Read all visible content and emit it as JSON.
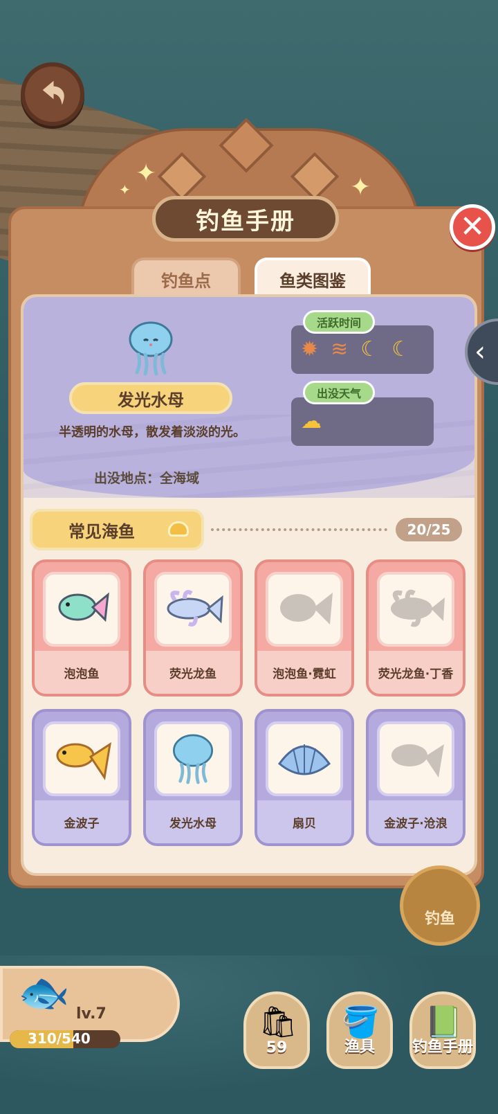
{
  "title": "钓鱼手册",
  "tabs": [
    "钓鱼点",
    "鱼类图鉴"
  ],
  "selected_fish": {
    "name": "发光水母",
    "description": "半透明的水母，散发着淡淡的光。",
    "location_text": "出没地点：全海域",
    "active_time_label": "活跃时间",
    "weather_label": "出没天气"
  },
  "category": {
    "name": "常见海鱼",
    "count": "20/25"
  },
  "fish_cards": [
    {
      "name": "泡泡鱼",
      "style": "pink",
      "icon": "rainbow-fish-icon",
      "discovered": true
    },
    {
      "name": "荧光龙鱼",
      "style": "pink",
      "icon": "dragon-fish-icon",
      "discovered": true
    },
    {
      "name": "泡泡鱼·霓虹",
      "style": "pink",
      "icon": "fish-silhouette-icon",
      "discovered": false
    },
    {
      "name": "荧光龙鱼·丁香",
      "style": "pink",
      "icon": "dragon-silhouette-icon",
      "discovered": false
    },
    {
      "name": "金波子",
      "style": "purple",
      "icon": "goldfish-icon",
      "discovered": true
    },
    {
      "name": "发光水母",
      "style": "purple",
      "icon": "jellyfish-icon",
      "discovered": true
    },
    {
      "name": "扇贝",
      "style": "purple",
      "icon": "scallop-icon",
      "discovered": true
    },
    {
      "name": "金波子·沧浪",
      "style": "purple",
      "icon": "goldfish-silhouette-icon",
      "discovered": false
    }
  ],
  "player": {
    "level": "lv.7",
    "xp_text": "310/540",
    "xp_fraction": 0.574
  },
  "fish_button_label": "钓鱼",
  "dock": {
    "bait_count": "59",
    "gear_label": "渔具",
    "book_label": "钓鱼手册"
  },
  "colors": {
    "panel": "#c78d62",
    "accent_yellow": "#f7d37c",
    "info_purple": "#b9b2dd",
    "close_red": "#e7534a"
  }
}
